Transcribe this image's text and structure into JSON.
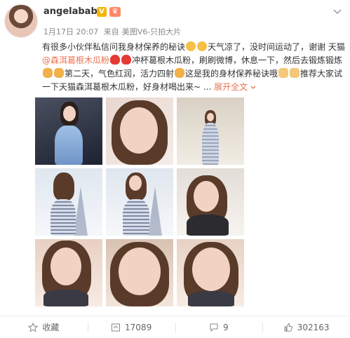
{
  "user": {
    "name": "angelababy",
    "vip_badge": "V",
    "level_badge": "♛"
  },
  "meta": {
    "time": "1月17日 20:07",
    "source_prefix": "来自",
    "source": "美图V6-只拍大片"
  },
  "post": {
    "t1": "有很多小伙伴私信问我身材保养的秘诀",
    "t2": "天气凉了，没时间运动了，谢谢 天猫",
    "mention": "@森洱葛根木瓜粉",
    "t3": "冲杯葛根木瓜粉，刷刷微博，休息一下，然后去锻炼锻炼",
    "t4": "第二天，气色红润，活力四射",
    "t5": "这是我的身材保养秘诀哦",
    "t6": "推荐大家试一下天猫森洱葛根木瓜粉，好身材喝出来~ ...",
    "expand": "展开全文",
    "expand_icon": "chevron-down-icon"
  },
  "actions": {
    "favorite": "收藏",
    "repost": "17089",
    "comment": "9",
    "like": "302163"
  },
  "colors": {
    "link": "#eb7350",
    "vip": "#f7b500"
  }
}
